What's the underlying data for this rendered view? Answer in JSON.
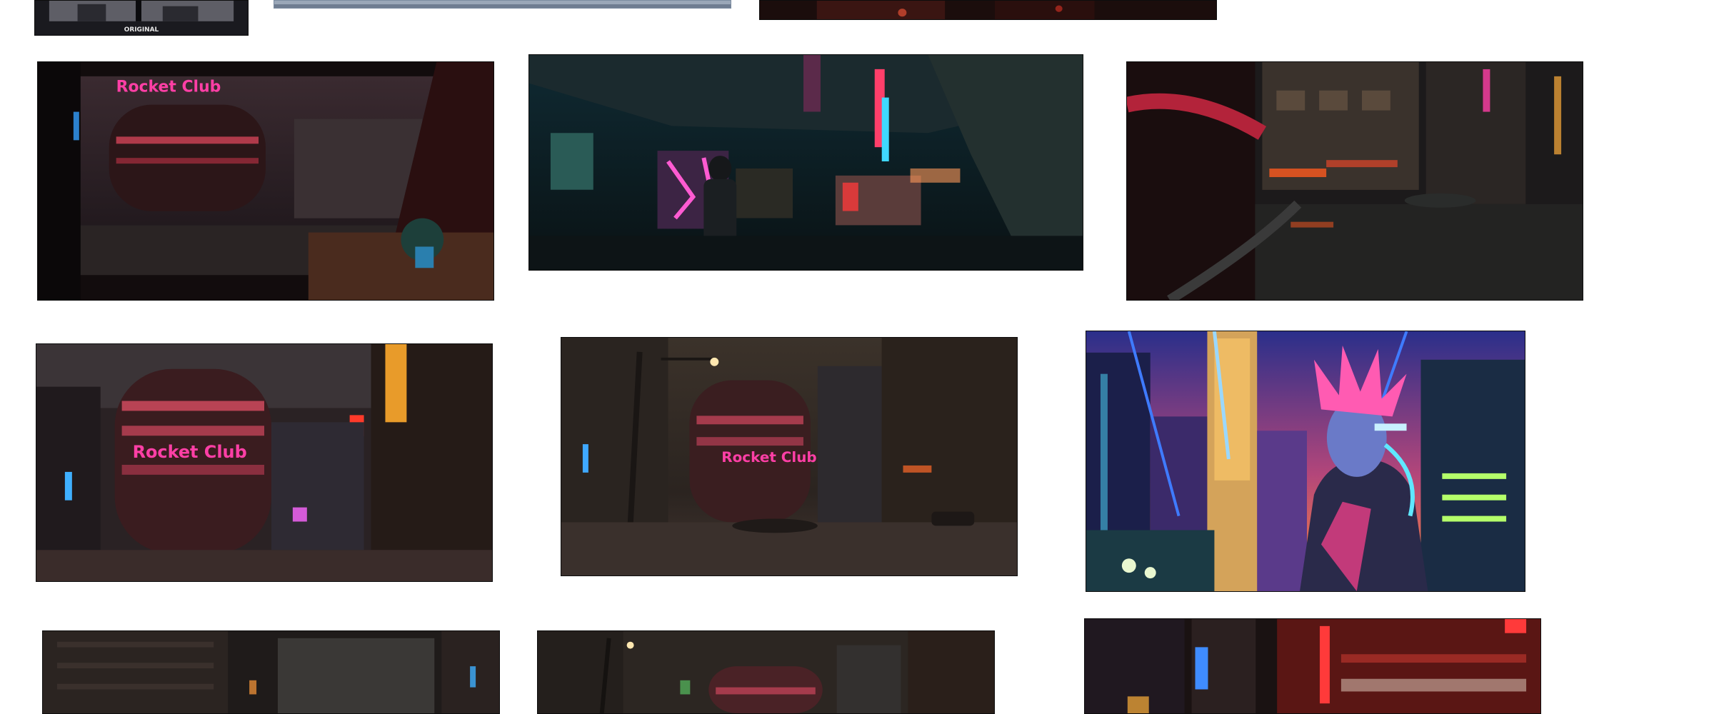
{
  "gallery": {
    "items": [
      {
        "id": "thumb-1",
        "logo_text": "ORIGINAL"
      },
      {
        "id": "thumb-2"
      },
      {
        "id": "thumb-3"
      },
      {
        "id": "thumb-4",
        "sign_text": "Rocket Club"
      },
      {
        "id": "thumb-5"
      },
      {
        "id": "thumb-6"
      },
      {
        "id": "thumb-7",
        "sign_text": "Rocket Club"
      },
      {
        "id": "thumb-8",
        "sign_text": "Rocket Club"
      },
      {
        "id": "thumb-9"
      },
      {
        "id": "thumb-10"
      },
      {
        "id": "thumb-11"
      },
      {
        "id": "thumb-12"
      }
    ]
  },
  "colors": {
    "page_background": "#ffffff",
    "neon_pink": "#ff3fa6",
    "neon_cyan": "#35e3ff",
    "neon_blue": "#3f7bff",
    "warm_orange": "#ff8a2a",
    "night_dark": "#0d0d12"
  }
}
